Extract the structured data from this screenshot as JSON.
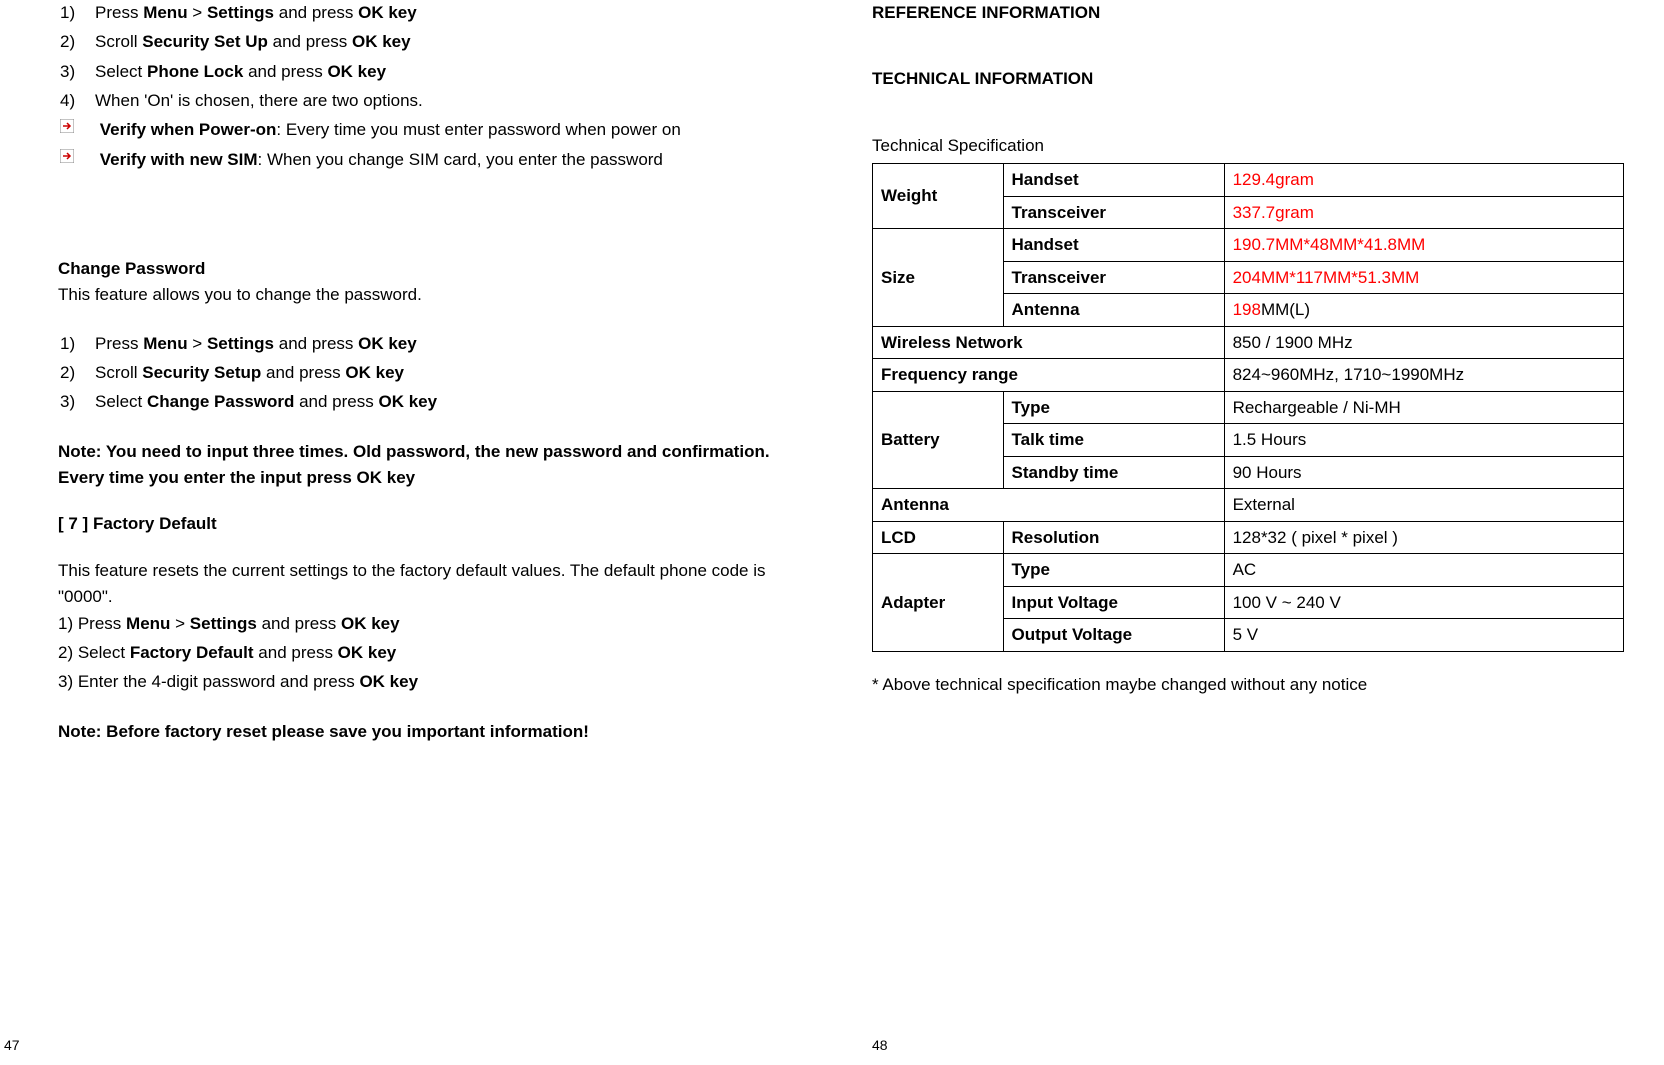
{
  "left": {
    "steps_a": [
      {
        "num": "1)",
        "pre": "Press ",
        "b1": "Menu",
        "mid": " > ",
        "b2": "Settings",
        "post": " and press ",
        "b3": "OK key"
      },
      {
        "num": "2)",
        "pre": "Scroll ",
        "b1": "Security Set Up",
        "mid": " and press ",
        "b2": "OK key",
        "post": "",
        "b3": ""
      },
      {
        "num": "3)",
        "pre": "Select ",
        "b1": "Phone Lock",
        "mid": " and press ",
        "b2": "OK key",
        "post": "",
        "b3": ""
      },
      {
        "num": "4)",
        "plain": "When 'On' is chosen, there are two options."
      }
    ],
    "arrows": [
      {
        "b": "Verify when Power-on",
        "rest": ": Every time you must enter password when power on"
      },
      {
        "b": "Verify with new SIM",
        "rest": ": When you change SIM card, you enter the password"
      }
    ],
    "change_pw_title": "Change Password",
    "change_pw_desc": "This feature allows you to change the password.",
    "steps_b": [
      {
        "num": "1)",
        "pre": "Press ",
        "b1": "Menu",
        "mid": " > ",
        "b2": "Settings",
        "post": " and press ",
        "b3": "OK key"
      },
      {
        "num": "2)",
        "pre": "Scroll ",
        "b1": "Security Setup",
        "mid": " and press ",
        "b2": "OK key",
        "post": "",
        "b3": ""
      },
      {
        "num": "3)",
        "pre": "Select ",
        "b1": "Change Password",
        "mid": " and press ",
        "b2": "OK key",
        "post": "",
        "b3": ""
      }
    ],
    "note_pw": "Note: You need to input three times. Old password, the new password and confirmation. Every time you enter the input press OK key",
    "factory_title": "[ 7 ]   Factory Default",
    "factory_desc": "This feature resets the current settings to the factory default values. The default phone code is \"0000\".",
    "steps_c": [
      {
        "pre": "1) Press ",
        "b1": "Menu",
        "mid": " > ",
        "b2": "Settings",
        "post": " and press ",
        "b3": "OK key"
      },
      {
        "pre": "2) Select ",
        "b1": "Factory Default",
        "mid": " and press ",
        "b2": "OK key",
        "post": "",
        "b3": ""
      },
      {
        "pre": "3) Enter the 4-digit password and press ",
        "b1": "OK key",
        "mid": "",
        "b2": "",
        "post": "",
        "b3": ""
      }
    ],
    "note_factory": "Note: Before factory reset please save you important information!",
    "page_num": "47"
  },
  "right": {
    "h1": "REFERENCE INFORMATION",
    "h2": "TECHNICAL INFORMATION",
    "tech_spec_label": "Technical Specification",
    "table": {
      "weight_label": "Weight",
      "weight_handset_k": "Handset",
      "weight_handset_v": "129.4gram",
      "weight_trans_k": "Transceiver",
      "weight_trans_v": "337.7gram",
      "size_label": "Size",
      "size_handset_k": "Handset",
      "size_handset_v": "190.7MM*48MM*41.8MM",
      "size_trans_k": "Transceiver",
      "size_trans_v": "204MM*117MM*51.3MM",
      "size_ant_k": "Antenna",
      "size_ant_v_red": "198",
      "size_ant_v_rest": "MM(L)",
      "wnet_k": "Wireless Network",
      "wnet_v": "850 / 1900 MHz",
      "freq_k": "Frequency range",
      "freq_v": "824~960MHz, 1710~1990MHz",
      "batt_label": "Battery",
      "batt_type_k": "Type",
      "batt_type_v": "Rechargeable / Ni-MH",
      "batt_talk_k": "Talk time",
      "batt_talk_v": "1.5 Hours",
      "batt_stby_k": "Standby time",
      "batt_stby_v": "90 Hours",
      "ant_k": "Antenna",
      "ant_v": "External",
      "lcd_label": "LCD",
      "lcd_res_k": "Resolution",
      "lcd_res_v": "128*32 ( pixel * pixel )",
      "adp_label": "Adapter",
      "adp_type_k": "Type",
      "adp_type_v": "AC",
      "adp_in_k": "Input Voltage",
      "adp_in_v": "100 V ~ 240 V",
      "adp_out_k": "Output Voltage",
      "adp_out_v": "5 V"
    },
    "footnote": "* Above technical specification maybe changed without any notice",
    "page_num": "48"
  }
}
